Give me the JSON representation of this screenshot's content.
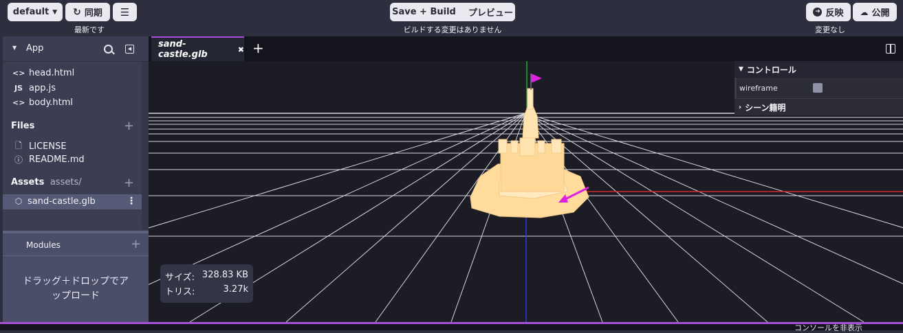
{
  "toolbar": {
    "branch": "default",
    "sync_label": "同期",
    "sync_status": "最新です",
    "build_label": "Save + Build",
    "preview_label": "プレビュー",
    "build_status": "ビルドする変更はありません",
    "revert_label": "反映",
    "publish_label": "公開",
    "publish_status": "変更なし"
  },
  "sidebar": {
    "app_title": "App",
    "app_files": [
      {
        "icon": "<>",
        "name": "head.html"
      },
      {
        "icon": "JS",
        "name": "app.js"
      },
      {
        "icon": "<>",
        "name": "body.html"
      }
    ],
    "files_title": "Files",
    "files": [
      {
        "icon": "file",
        "name": "LICENSE"
      },
      {
        "icon": "info",
        "name": "README.md"
      }
    ],
    "assets_title": "Assets",
    "assets_path": "assets/",
    "assets": [
      {
        "name": "sand-castle.glb"
      }
    ],
    "modules_title": "Modules",
    "drop_hint_line1": "ドラッグ＋ドロップでア",
    "drop_hint_line2": "ップロード"
  },
  "editor": {
    "tab_label": "sand-castle.glb",
    "split_icon": "split-view-icon"
  },
  "controls": {
    "header": "コントロール",
    "wireframe_label": "wireframe",
    "wireframe_checked": false,
    "scene_info": "シーン籍明"
  },
  "info": {
    "size_label": "サイズ:",
    "size_value": "328.83 KB",
    "tris_label": "トリス:",
    "tris_value": "3.27k"
  },
  "bottom": {
    "console_label": "コンソールを非表示"
  },
  "colors": {
    "accent": "#a74fd8",
    "sand": "#ffe0a6",
    "marker": "#e020e0"
  }
}
